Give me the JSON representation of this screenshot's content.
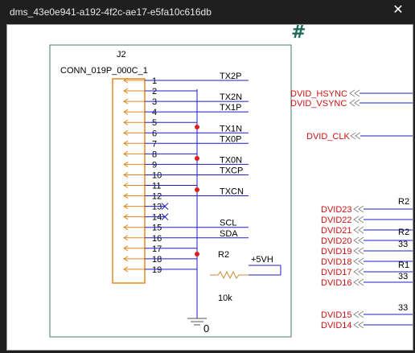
{
  "window": {
    "title": "dms_43e0e941-a192-4f2c-ae17-e5fa10c616db",
    "close_glyph": "✕"
  },
  "schematic": {
    "hash_mark": "#",
    "connector": {
      "ref": "J2",
      "part": "CONN_019P_000C_1",
      "pins": [
        {
          "num": "1",
          "net": "TX2P"
        },
        {
          "num": "2",
          "net": ""
        },
        {
          "num": "3",
          "net": "TX2N"
        },
        {
          "num": "4",
          "net": "TX1P"
        },
        {
          "num": "5",
          "net": ""
        },
        {
          "num": "6",
          "net": "TX1N"
        },
        {
          "num": "7",
          "net": "TX0P"
        },
        {
          "num": "8",
          "net": ""
        },
        {
          "num": "9",
          "net": "TX0N"
        },
        {
          "num": "10",
          "net": "TXCP"
        },
        {
          "num": "11",
          "net": ""
        },
        {
          "num": "12",
          "net": "TXCN"
        },
        {
          "num": "13",
          "net": ""
        },
        {
          "num": "14",
          "net": ""
        },
        {
          "num": "15",
          "net": "SCL"
        },
        {
          "num": "16",
          "net": "SDA"
        },
        {
          "num": "17",
          "net": ""
        },
        {
          "num": "18",
          "net": ""
        },
        {
          "num": "19",
          "net": ""
        }
      ]
    },
    "resistor": {
      "ref": "R2",
      "value": "10k",
      "rail": "+5VH"
    },
    "ground_label": "0",
    "right_nets": [
      {
        "name": "DVID_HSYNC"
      },
      {
        "name": "DVID_VSYNC"
      },
      {
        "name": "DVID_CLK"
      },
      {
        "name": "DVID23"
      },
      {
        "name": "DVID22"
      },
      {
        "name": "DVID21"
      },
      {
        "name": "DVID20"
      },
      {
        "name": "DVID19"
      },
      {
        "name": "DVID18"
      },
      {
        "name": "DVID17"
      },
      {
        "name": "DVID16"
      },
      {
        "name": "DVID15"
      },
      {
        "name": "DVID14"
      }
    ],
    "right_fragments": [
      "R2",
      "R2",
      "33",
      "R1",
      "33",
      "33"
    ],
    "colors": {
      "net_label": "#cc1111",
      "junction": "#e02020",
      "wire": "#1e1ec8",
      "pin": "#e08a1e",
      "hash": "#1c6b5a"
    }
  }
}
